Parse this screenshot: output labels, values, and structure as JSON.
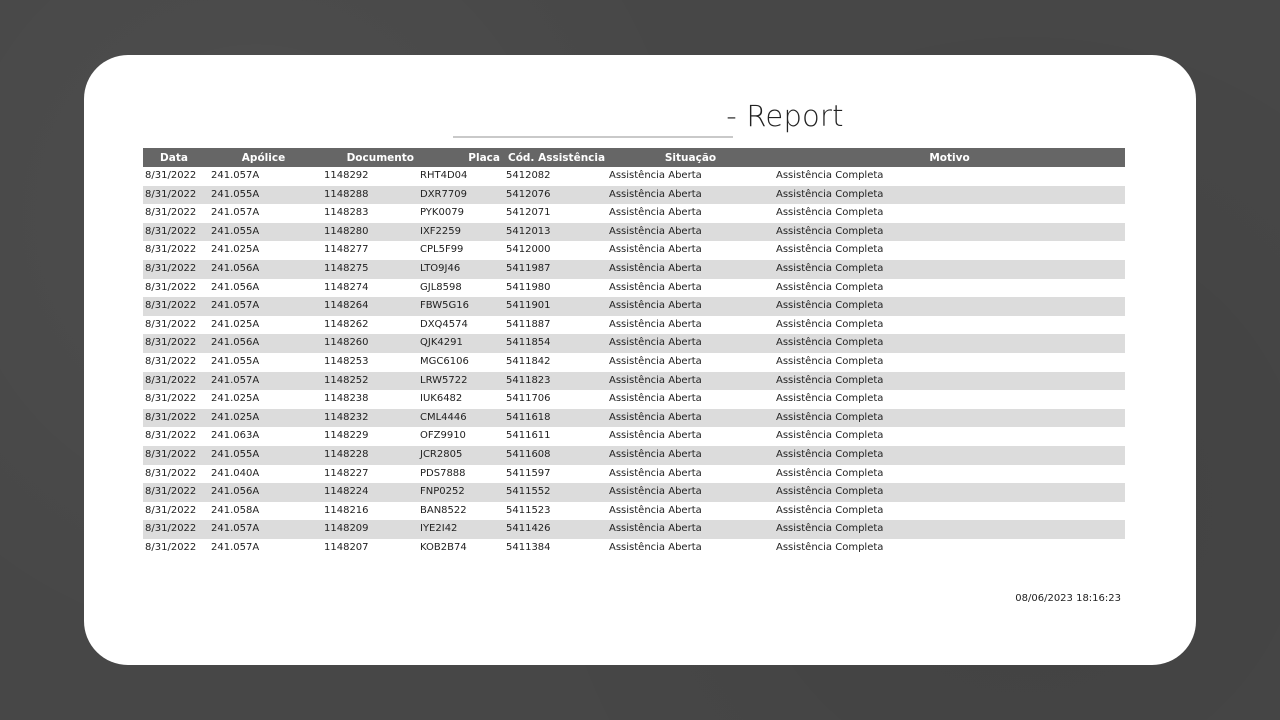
{
  "report": {
    "title": "- Report",
    "timestamp": "08/06/2023 18:16:23",
    "columns": [
      "Data",
      "Apólice",
      "Documento",
      "Placa",
      "Cód. Assistência",
      "Situação",
      "Motivo"
    ],
    "rows": [
      [
        "8/31/2022",
        "241.057A",
        "1148292",
        "RHT4D04",
        "5412082",
        "Assistência Aberta",
        "Assistência Completa"
      ],
      [
        "8/31/2022",
        "241.055A",
        "1148288",
        "DXR7709",
        "5412076",
        "Assistência Aberta",
        "Assistência Completa"
      ],
      [
        "8/31/2022",
        "241.057A",
        "1148283",
        "PYK0079",
        "5412071",
        "Assistência Aberta",
        "Assistência Completa"
      ],
      [
        "8/31/2022",
        "241.055A",
        "1148280",
        "IXF2259",
        "5412013",
        "Assistência Aberta",
        "Assistência Completa"
      ],
      [
        "8/31/2022",
        "241.025A",
        "1148277",
        "CPL5F99",
        "5412000",
        "Assistência Aberta",
        "Assistência Completa"
      ],
      [
        "8/31/2022",
        "241.056A",
        "1148275",
        "LTO9J46",
        "5411987",
        "Assistência Aberta",
        "Assistência Completa"
      ],
      [
        "8/31/2022",
        "241.056A",
        "1148274",
        "GJL8598",
        "5411980",
        "Assistência Aberta",
        "Assistência Completa"
      ],
      [
        "8/31/2022",
        "241.057A",
        "1148264",
        "FBW5G16",
        "5411901",
        "Assistência Aberta",
        "Assistência Completa"
      ],
      [
        "8/31/2022",
        "241.025A",
        "1148262",
        "DXQ4574",
        "5411887",
        "Assistência Aberta",
        "Assistência Completa"
      ],
      [
        "8/31/2022",
        "241.056A",
        "1148260",
        "QJK4291",
        "5411854",
        "Assistência Aberta",
        "Assistência Completa"
      ],
      [
        "8/31/2022",
        "241.055A",
        "1148253",
        "MGC6106",
        "5411842",
        "Assistência Aberta",
        "Assistência Completa"
      ],
      [
        "8/31/2022",
        "241.057A",
        "1148252",
        "LRW5722",
        "5411823",
        "Assistência Aberta",
        "Assistência Completa"
      ],
      [
        "8/31/2022",
        "241.025A",
        "1148238",
        "IUK6482",
        "5411706",
        "Assistência Aberta",
        "Assistência Completa"
      ],
      [
        "8/31/2022",
        "241.025A",
        "1148232",
        "CML4446",
        "5411618",
        "Assistência Aberta",
        "Assistência Completa"
      ],
      [
        "8/31/2022",
        "241.063A",
        "1148229",
        "OFZ9910",
        "5411611",
        "Assistência Aberta",
        "Assistência Completa"
      ],
      [
        "8/31/2022",
        "241.055A",
        "1148228",
        "JCR2805",
        "5411608",
        "Assistência Aberta",
        "Assistência Completa"
      ],
      [
        "8/31/2022",
        "241.040A",
        "1148227",
        "PDS7888",
        "5411597",
        "Assistência Aberta",
        "Assistência Completa"
      ],
      [
        "8/31/2022",
        "241.056A",
        "1148224",
        "FNP0252",
        "5411552",
        "Assistência Aberta",
        "Assistência Completa"
      ],
      [
        "8/31/2022",
        "241.058A",
        "1148216",
        "BAN8522",
        "5411523",
        "Assistência Aberta",
        "Assistência Completa"
      ],
      [
        "8/31/2022",
        "241.057A",
        "1148209",
        "IYE2I42",
        "5411426",
        "Assistência Aberta",
        "Assistência Completa"
      ],
      [
        "8/31/2022",
        "241.057A",
        "1148207",
        "KOB2B74",
        "5411384",
        "Assistência Aberta",
        "Assistência Completa"
      ]
    ]
  },
  "colors": {
    "background": "#474747",
    "card": "#ffffff",
    "header_bg": "#666666",
    "header_text": "#ffffff",
    "stripe": "#dcdcdc",
    "title_rule": "#c9c9c9"
  }
}
